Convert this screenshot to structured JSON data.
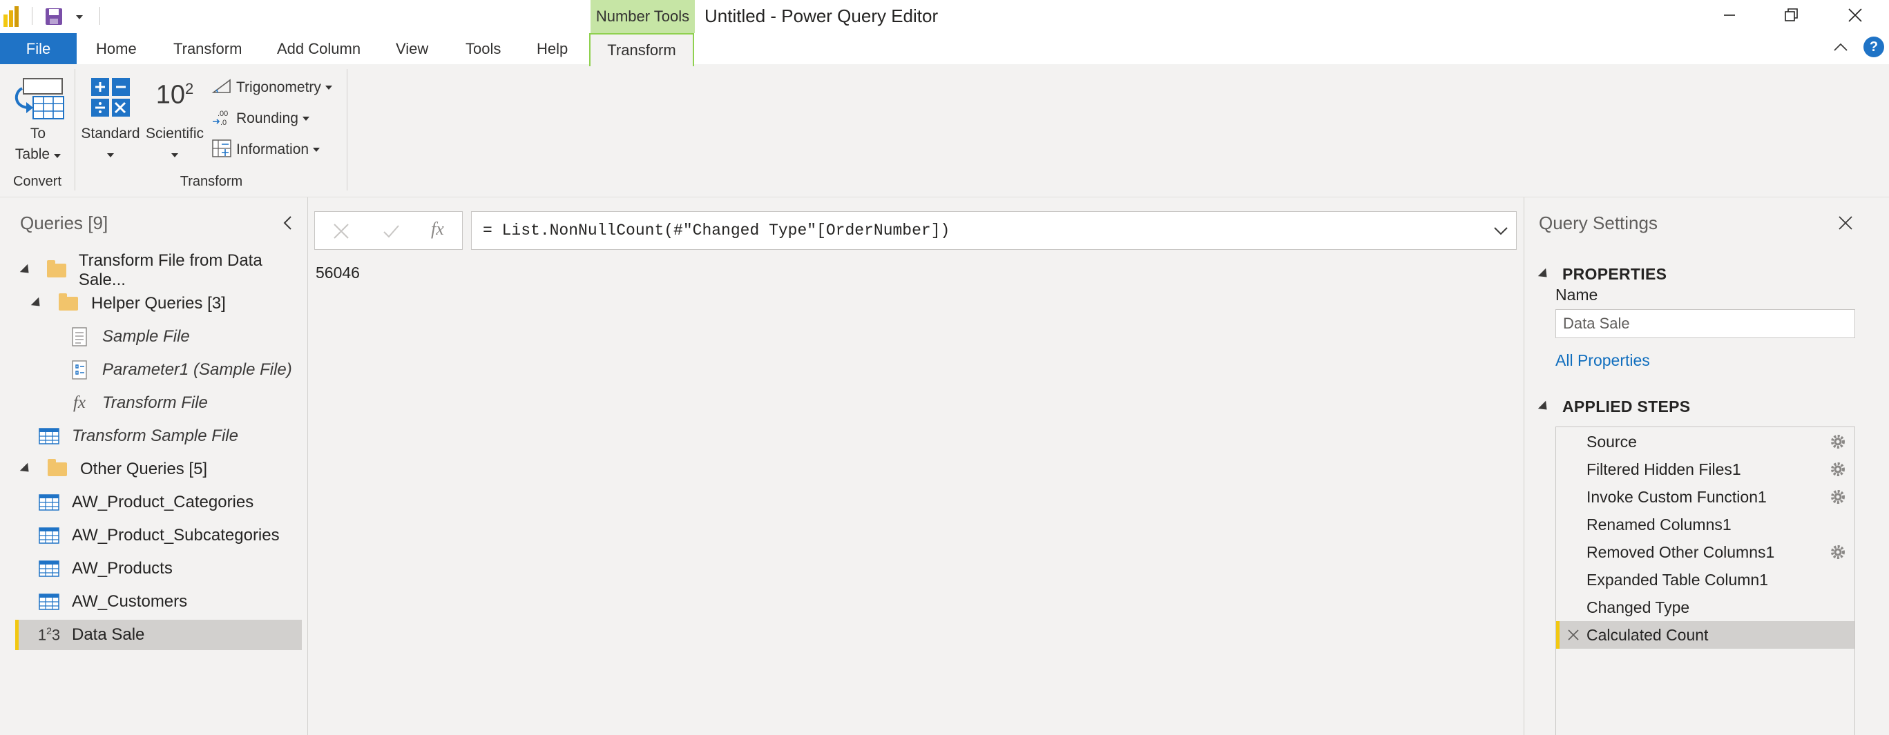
{
  "titlebar": {
    "context_tab": "Number Tools",
    "window_title": "Untitled - Power Query Editor"
  },
  "tabs": {
    "file": "File",
    "home": "Home",
    "transform": "Transform",
    "add_column": "Add Column",
    "view": "View",
    "tools": "Tools",
    "help": "Help",
    "transform_active": "Transform"
  },
  "ribbon": {
    "to_table_line1": "To",
    "to_table_line2": "Table",
    "convert_group": "Convert",
    "standard": "Standard",
    "scientific": "Scientific",
    "scientific_glyph": "10",
    "scientific_exp": "2",
    "trigonometry": "Trigonometry",
    "rounding": "Rounding",
    "information": "Information",
    "transform_group": "Transform"
  },
  "queries": {
    "header": "Queries [9]",
    "items": [
      {
        "label": "Transform File from Data Sale...",
        "icon": "folder-icon"
      },
      {
        "label": "Helper Queries [3]",
        "icon": "folder-icon"
      },
      {
        "label": "Sample File",
        "icon": "file-icon"
      },
      {
        "label": "Parameter1 (Sample File)",
        "icon": "parameter-icon"
      },
      {
        "label": "Transform File",
        "icon": "function-icon"
      },
      {
        "label": "Transform Sample File",
        "icon": "table-icon"
      },
      {
        "label": "Other Queries [5]",
        "icon": "folder-icon"
      },
      {
        "label": "AW_Product_Categories",
        "icon": "table-icon"
      },
      {
        "label": "AW_Product_Subcategories",
        "icon": "table-icon"
      },
      {
        "label": "AW_Products",
        "icon": "table-icon"
      },
      {
        "label": "AW_Customers",
        "icon": "table-icon"
      },
      {
        "label": "Data Sale",
        "icon": "number-icon"
      }
    ]
  },
  "formula": {
    "fx": "fx",
    "text": "= List.NonNullCount(#\"Changed Type\"[OrderNumber])"
  },
  "result": {
    "value": "56046"
  },
  "settings": {
    "title": "Query Settings",
    "properties_header": "PROPERTIES",
    "name_label": "Name",
    "name_value": "Data Sale",
    "all_properties": "All Properties",
    "applied_steps_header": "APPLIED STEPS",
    "steps": [
      {
        "label": "Source",
        "gear": true
      },
      {
        "label": "Filtered Hidden Files1",
        "gear": true
      },
      {
        "label": "Invoke Custom Function1",
        "gear": true
      },
      {
        "label": "Renamed Columns1",
        "gear": false
      },
      {
        "label": "Removed Other Columns1",
        "gear": true
      },
      {
        "label": "Expanded Table Column1",
        "gear": false
      },
      {
        "label": "Changed Type",
        "gear": false
      },
      {
        "label": "Calculated Count",
        "gear": false
      }
    ]
  },
  "colors": {
    "file_tab": "#1f73c6",
    "context_tab": "#c6e5a5",
    "selection": "#d2d0ce",
    "selection_marker": "#f2c811",
    "link": "#106ebe"
  }
}
